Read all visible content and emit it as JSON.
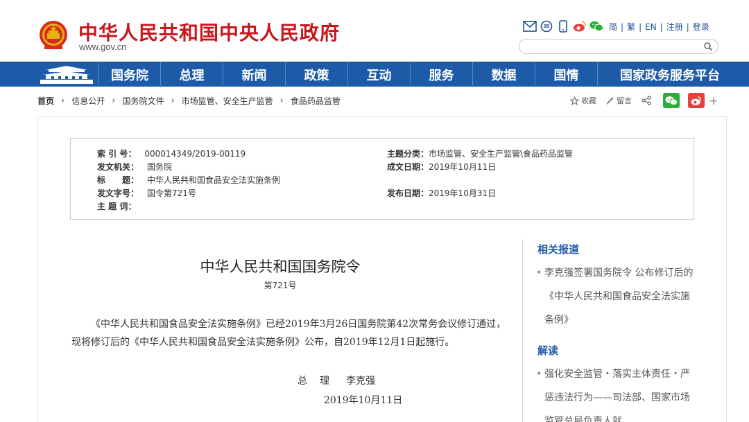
{
  "header": {
    "title": "中华人民共和国中央人民政府",
    "url": "www.gov.cn",
    "icons": [
      "mail-icon",
      "message-icon",
      "mobile-icon",
      "weibo-icon",
      "wechat-icon"
    ],
    "links": [
      "简",
      "繁",
      "EN",
      "注册",
      "登录"
    ],
    "search_placeholder": ""
  },
  "nav": {
    "items": [
      "国务院",
      "总理",
      "新闻",
      "政策",
      "互动",
      "服务",
      "数据",
      "国情",
      "国家政务服务平台"
    ]
  },
  "breadcrumb": [
    "首页",
    "信息公开",
    "国务院文件",
    "市场监管、安全生产监管",
    "食品药品监管"
  ],
  "share": {
    "collect": "收藏",
    "comment": "留言",
    "plus": "+"
  },
  "info": {
    "index_k": "索 引 号：",
    "index_v": "000014349/2019-00119",
    "topic_k": "主题分类：",
    "topic_v": "市场监管、安全生产监管\\食品药品监管",
    "org_k": "发文机关：",
    "org_v": "国务院",
    "date_k": "成文日期：",
    "date_v": "2019年10月11日",
    "title_k": "标　　题：",
    "title_v": "中华人民共和国食品安全法实施条例",
    "num_k": "发文字号：",
    "num_v": "国令第721号",
    "pub_k": "发布日期：",
    "pub_v": "2019年10月31日",
    "kw_k": "主 题 词："
  },
  "article": {
    "title": "中华人民共和国国务院令",
    "number": "第721号",
    "body": "《中华人民共和国食品安全法实施条例》已经2019年3月26日国务院第42次常务会议修订通过，现将修订后的《中华人民共和国食品安全法实施条例》公布，自2019年12月1日起施行。",
    "sign_title": "总理",
    "sign_name": "李克强",
    "date": "2019年10月11日"
  },
  "sidebar": {
    "related_title": "相关报道",
    "related": [
      "李克强签署国务院令 公布修订后的《中华人民共和国食品安全法实施条例》"
    ],
    "read_title": "解读",
    "read": [
      "强化安全监管・落实主体责任・严惩违法行为——司法部、国家市场监管总局负责人就"
    ]
  },
  "colors": {
    "brand_red": "#c8161d",
    "nav_blue": "#1d5aa7",
    "wechat_green": "#2aae3a",
    "weibo_red": "#e5413a"
  }
}
